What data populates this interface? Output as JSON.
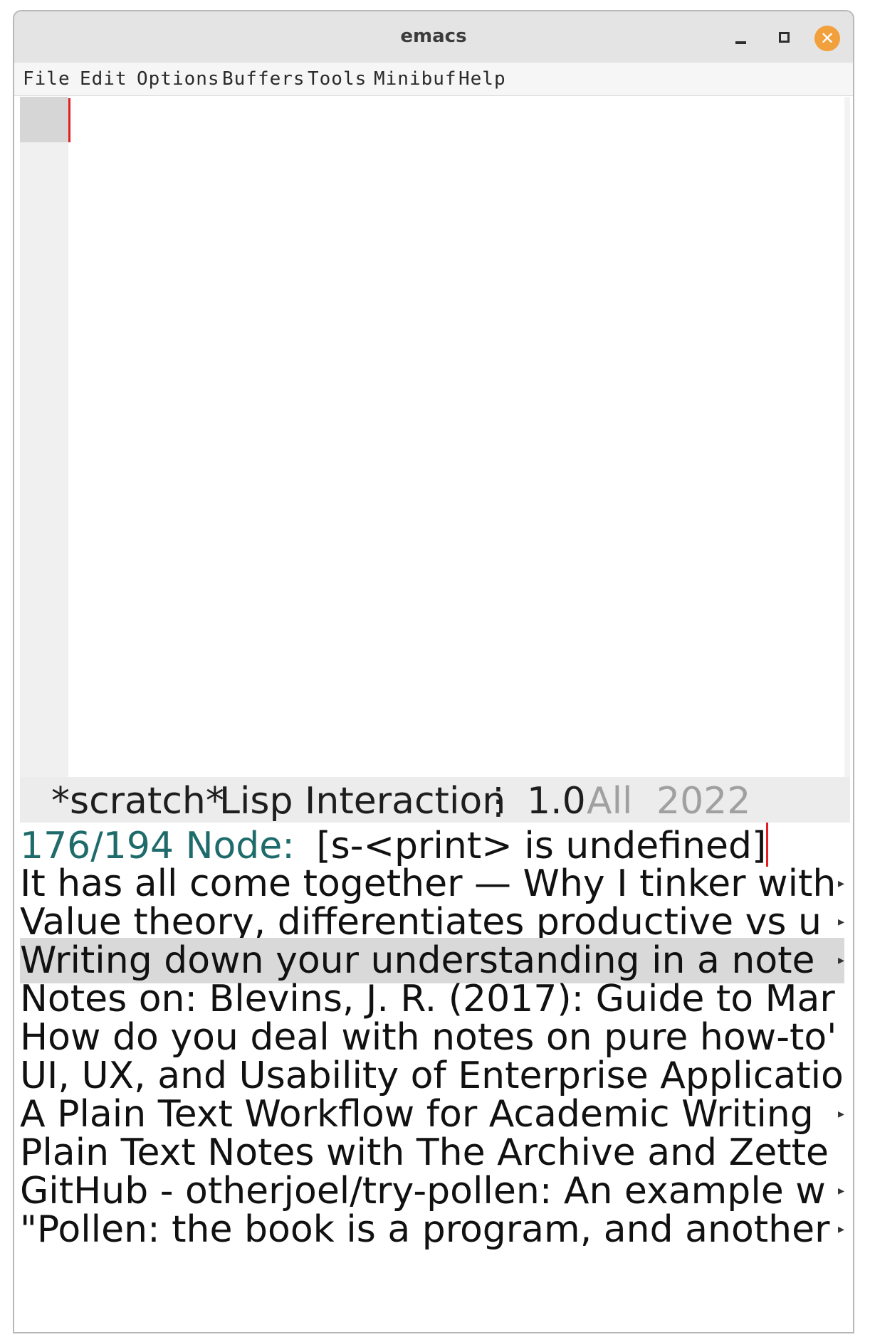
{
  "window": {
    "title": "emacs"
  },
  "menubar": {
    "items": [
      "File",
      "Edit",
      "Options",
      "Buffers",
      "Tools",
      "Minibuf",
      "Help"
    ]
  },
  "modeline": {
    "buffer_name": "*scratch*",
    "mode": "Lisp Interaction",
    "separator": "⋮",
    "position": "1.0",
    "scroll": "All",
    "date_fragment": "2022"
  },
  "minibuffer": {
    "count": "176/194",
    "prompt": "Node:",
    "message": "[s-<print> is undefined]",
    "candidates": [
      "It has all come together — Why I tinker with",
      "Value theory, differentiates productive vs u",
      "Writing down your understanding in a note",
      "Notes on: Blevins, J. R. (2017): Guide to Mar",
      "How do you deal with notes on pure how-to'",
      "UI, UX, and Usability of Enterprise Applicatio",
      "A Plain Text Workflow for Academic Writing",
      "Plain Text Notes with The Archive and Zette",
      "GitHub - otherjoel/try-pollen: An example w",
      "\"Pollen: the book is a program, and another"
    ],
    "selected_index": 2,
    "truncation_glyph": "▸"
  },
  "colors": {
    "prompt": "#1f6b6b",
    "cursor": "#e02020",
    "selection": "#d9d9d9",
    "close_button": "#f2a03c"
  }
}
